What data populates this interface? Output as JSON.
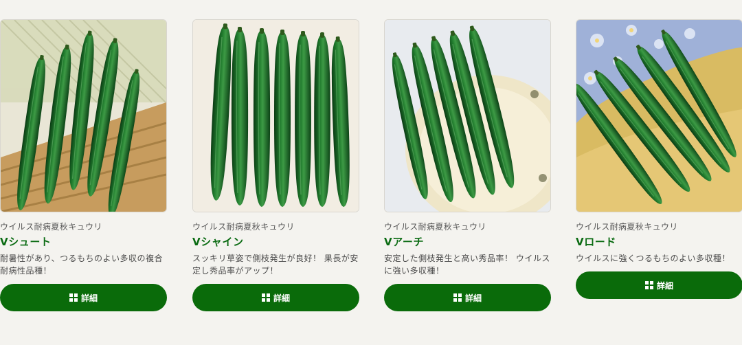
{
  "products": [
    {
      "image_icon": "cucumber-basket-photo",
      "category": "ウイルス耐病夏秋キュウリ",
      "name": "Vシュート",
      "description": "耐暑性があり、つるもちのよい多収の複合耐病性品種！",
      "button_label": "詳細",
      "button_icon": "grid-icon"
    },
    {
      "image_icon": "cucumber-row-photo",
      "category": "ウイルス耐病夏秋キュウリ",
      "name": "Vシャイン",
      "description": "スッキリ草姿で側枝発生が良好！ 果長が安定し秀品率がアップ！",
      "button_label": "詳細",
      "button_icon": "grid-icon"
    },
    {
      "image_icon": "cucumber-plate-photo",
      "category": "ウイルス耐病夏秋キュウリ",
      "name": "Vアーチ",
      "description": "安定した側枝発生と高い秀品率！ ウイルスに強い多収種！",
      "button_label": "詳細",
      "button_icon": "grid-icon"
    },
    {
      "image_icon": "cucumber-cloth-basket-photo",
      "category": "ウイルス耐病夏秋キュウリ",
      "name": "Vロード",
      "description": "ウイルスに強くつるもちのよい多収種！",
      "button_label": "詳細",
      "button_icon": "grid-icon"
    }
  ],
  "colors": {
    "background": "#f4f3ef",
    "brand_green": "#0a6b0a",
    "name_green": "#0a6b12"
  }
}
